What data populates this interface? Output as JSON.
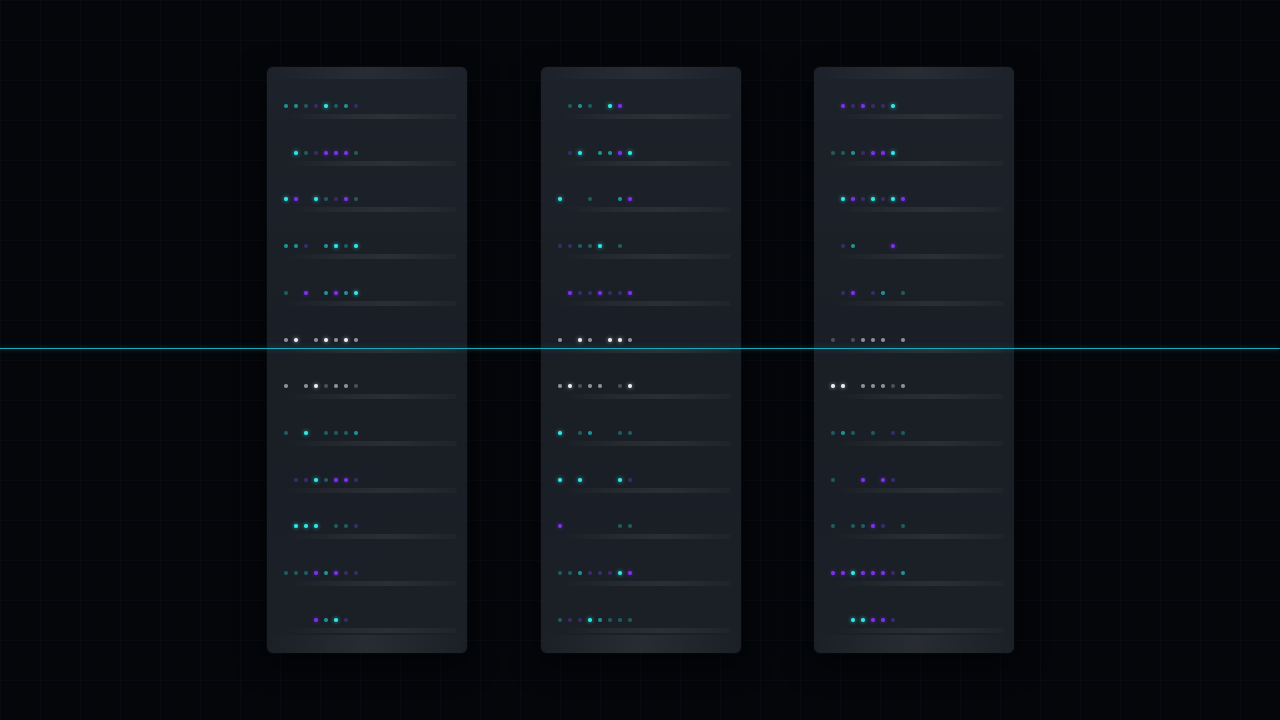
{
  "colors": {
    "background": "#04060a",
    "rack_body": "#1b1f26",
    "led_teal": "#2ee6e6",
    "led_purple": "#7b2ff0",
    "led_white": "#e8eaee",
    "scan_line": "#1aa7b8"
  },
  "led_states": [
    "off",
    "tdim",
    "tmid",
    "tbri",
    "pdim",
    "pbri",
    "wdim",
    "wmid",
    "wbri"
  ],
  "racks": [
    {
      "name": "rack-1",
      "units": [
        [
          "tmid",
          "tmid",
          "tdim",
          "pdim",
          "tbri",
          "tdim",
          "tmid",
          "pdim"
        ],
        [
          "off",
          "tbri",
          "tdim",
          "pdim",
          "pbri",
          "pbri",
          "pbri",
          "tdim"
        ],
        [
          "tbri",
          "pbri",
          "off",
          "tbri",
          "tdim",
          "pdim",
          "pbri",
          "tdim"
        ],
        [
          "tmid",
          "tmid",
          "pdim",
          "off",
          "tmid",
          "tbri",
          "tdim",
          "tbri"
        ],
        [
          "tdim",
          "off",
          "pbri",
          "off",
          "tmid",
          "pbri",
          "tmid",
          "tbri"
        ],
        [
          "wmid",
          "wbri",
          "off",
          "wmid",
          "wbri",
          "wmid",
          "wbri",
          "wmid"
        ],
        [
          "wmid",
          "off",
          "wmid",
          "wbri",
          "wdim",
          "wmid",
          "wmid",
          "wdim"
        ],
        [
          "tdim",
          "off",
          "tbri",
          "off",
          "tdim",
          "tdim",
          "tdim",
          "tmid"
        ],
        [
          "off",
          "pdim",
          "pdim",
          "tbri",
          "tdim",
          "pbri",
          "pbri",
          "pdim"
        ],
        [
          "off",
          "tbri",
          "tbri",
          "tbri",
          "off",
          "tdim",
          "tdim",
          "pdim"
        ],
        [
          "tdim",
          "tdim",
          "tdim",
          "pbri",
          "tmid",
          "pbri",
          "pdim",
          "pdim"
        ],
        [
          "off",
          "off",
          "off",
          "pbri",
          "tmid",
          "tbri",
          "pdim",
          "off"
        ]
      ]
    },
    {
      "name": "rack-2",
      "units": [
        [
          "off",
          "tdim",
          "tmid",
          "tdim",
          "off",
          "tbri",
          "pbri",
          "off"
        ],
        [
          "off",
          "pdim",
          "tbri",
          "off",
          "tmid",
          "tmid",
          "pbri",
          "tbri"
        ],
        [
          "tbri",
          "off",
          "off",
          "tdim",
          "off",
          "off",
          "tmid",
          "pbri"
        ],
        [
          "pdim",
          "pdim",
          "tdim",
          "tdim",
          "tbri",
          "off",
          "tdim",
          "off"
        ],
        [
          "off",
          "pbri",
          "pdim",
          "pdim",
          "pbri",
          "pdim",
          "pdim",
          "pbri"
        ],
        [
          "wmid",
          "off",
          "wbri",
          "wmid",
          "off",
          "wbri",
          "wbri",
          "wmid"
        ],
        [
          "wmid",
          "wbri",
          "wdim",
          "wmid",
          "wmid",
          "off",
          "wdim",
          "wbri"
        ],
        [
          "tbri",
          "off",
          "tdim",
          "tmid",
          "off",
          "off",
          "tdim",
          "tdim"
        ],
        [
          "tbri",
          "off",
          "tbri",
          "off",
          "off",
          "off",
          "tbri",
          "pdim"
        ],
        [
          "pbri",
          "off",
          "off",
          "off",
          "off",
          "off",
          "tdim",
          "tdim"
        ],
        [
          "tdim",
          "tdim",
          "tmid",
          "pdim",
          "pdim",
          "pdim",
          "tbri",
          "pbri"
        ],
        [
          "tdim",
          "pdim",
          "pdim",
          "tbri",
          "tmid",
          "tdim",
          "tdim",
          "tdim"
        ]
      ]
    },
    {
      "name": "rack-3",
      "units": [
        [
          "off",
          "pbri",
          "pdim",
          "pbri",
          "pdim",
          "pdim",
          "tbri",
          "off"
        ],
        [
          "tdim",
          "tdim",
          "tmid",
          "pdim",
          "pbri",
          "pbri",
          "tbri",
          "off"
        ],
        [
          "off",
          "tbri",
          "pbri",
          "pdim",
          "tbri",
          "pdim",
          "tbri",
          "pbri"
        ],
        [
          "off",
          "pdim",
          "tmid",
          "off",
          "off",
          "off",
          "pbri",
          "off"
        ],
        [
          "off",
          "pdim",
          "pbri",
          "off",
          "pdim",
          "tmid",
          "off",
          "tdim"
        ],
        [
          "wdim",
          "off",
          "wdim",
          "wmid",
          "wmid",
          "wmid",
          "off",
          "wmid"
        ],
        [
          "wbri",
          "wbri",
          "off",
          "wmid",
          "wmid",
          "wmid",
          "wdim",
          "wmid"
        ],
        [
          "tdim",
          "tmid",
          "tdim",
          "off",
          "tdim",
          "off",
          "pdim",
          "tdim"
        ],
        [
          "tdim",
          "off",
          "off",
          "pbri",
          "off",
          "pbri",
          "pdim",
          "off"
        ],
        [
          "tdim",
          "off",
          "tdim",
          "tdim",
          "pbri",
          "pdim",
          "off",
          "tdim"
        ],
        [
          "pbri",
          "pbri",
          "tbri",
          "pbri",
          "pbri",
          "pbri",
          "pdim",
          "tmid"
        ],
        [
          "off",
          "off",
          "tbri",
          "tbri",
          "pbri",
          "pbri",
          "pdim",
          "off"
        ]
      ]
    }
  ]
}
